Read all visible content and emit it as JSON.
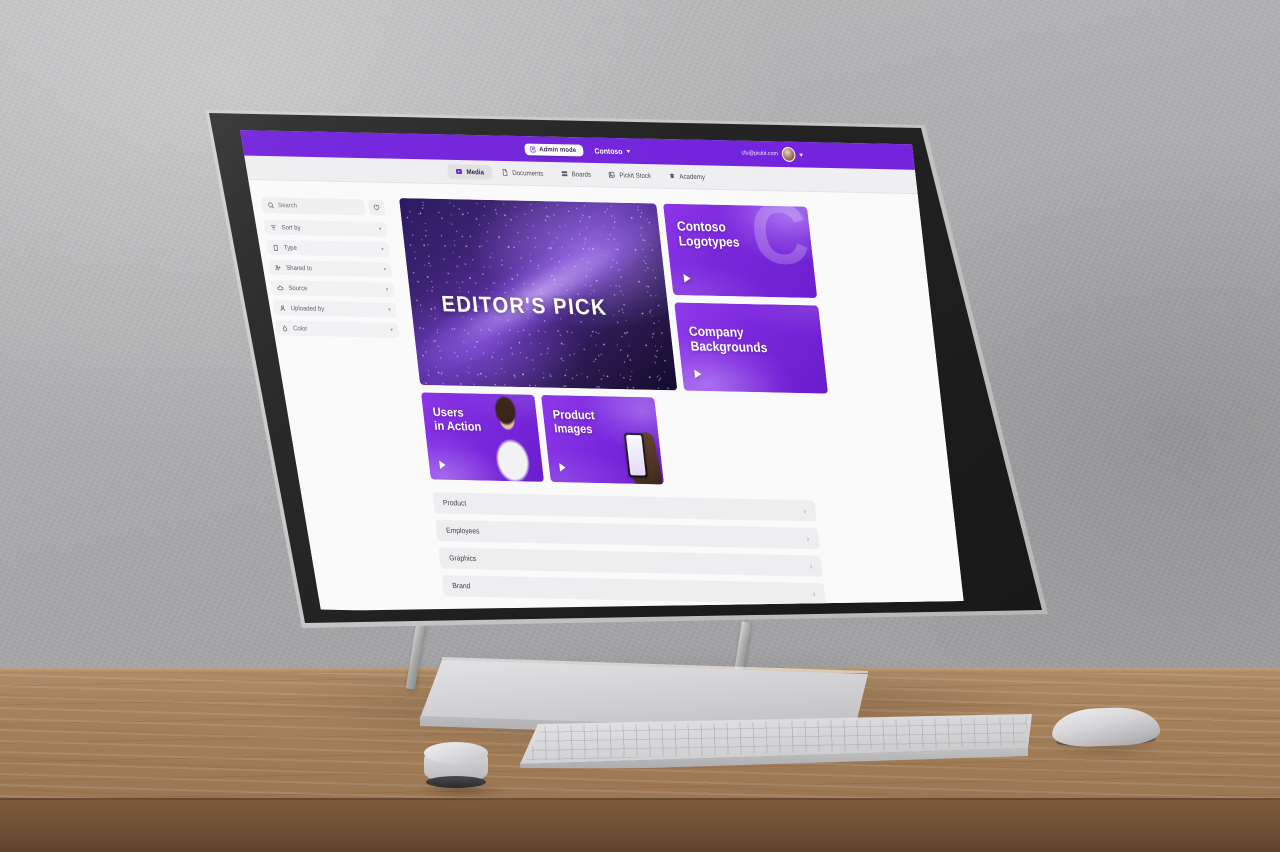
{
  "scene": {
    "device": "Surface Studio desktop computer",
    "wall_color": "#ACACAE",
    "desk_color": "#A8825E",
    "accessories": [
      "keyboard",
      "surface-dial",
      "arc-mouse"
    ]
  },
  "app": {
    "brand_purple": "#7324DC",
    "topbar": {
      "admin_badge": "Admin mode",
      "org_name": "Contoso",
      "user_email": "cfo@pickit.com"
    },
    "tabs": [
      {
        "label": "Media",
        "icon": "media-icon",
        "active": true
      },
      {
        "label": "Documents",
        "icon": "document-icon",
        "active": false
      },
      {
        "label": "Boards",
        "icon": "boards-icon",
        "active": false
      },
      {
        "label": "Pickit Stock",
        "icon": "stock-icon",
        "active": false
      },
      {
        "label": "Academy",
        "icon": "academy-icon",
        "active": false
      }
    ],
    "sidebar": {
      "search_placeholder": "Search",
      "favorites_icon": "heart-icon",
      "filters": [
        {
          "label": "Sort by",
          "icon": "sort-icon"
        },
        {
          "label": "Type",
          "icon": "type-icon"
        },
        {
          "label": "Shared to",
          "icon": "share-icon"
        },
        {
          "label": "Source",
          "icon": "cloud-icon"
        },
        {
          "label": "Uploaded by",
          "icon": "person-icon"
        },
        {
          "label": "Color",
          "icon": "droplet-icon"
        }
      ],
      "chevron": "▾"
    },
    "hero": {
      "title": "EDITOR'S PICK"
    },
    "cards": [
      {
        "title_line1": "Contoso",
        "title_line2": "Logotypes",
        "watermark": "C",
        "play": "▶"
      },
      {
        "title_line1": "Company",
        "title_line2": "Backgrounds",
        "play": "▶"
      },
      {
        "title_line1": "Users",
        "title_line2": "in Action",
        "play": "▶"
      },
      {
        "title_line1": "Product",
        "title_line2": "Images",
        "play": "▶"
      }
    ],
    "collections": [
      {
        "label": "Product",
        "chevron": "›"
      },
      {
        "label": "Employees",
        "chevron": "›"
      },
      {
        "label": "Graphics",
        "chevron": "›"
      },
      {
        "label": "Brand",
        "chevron": "›"
      }
    ]
  }
}
